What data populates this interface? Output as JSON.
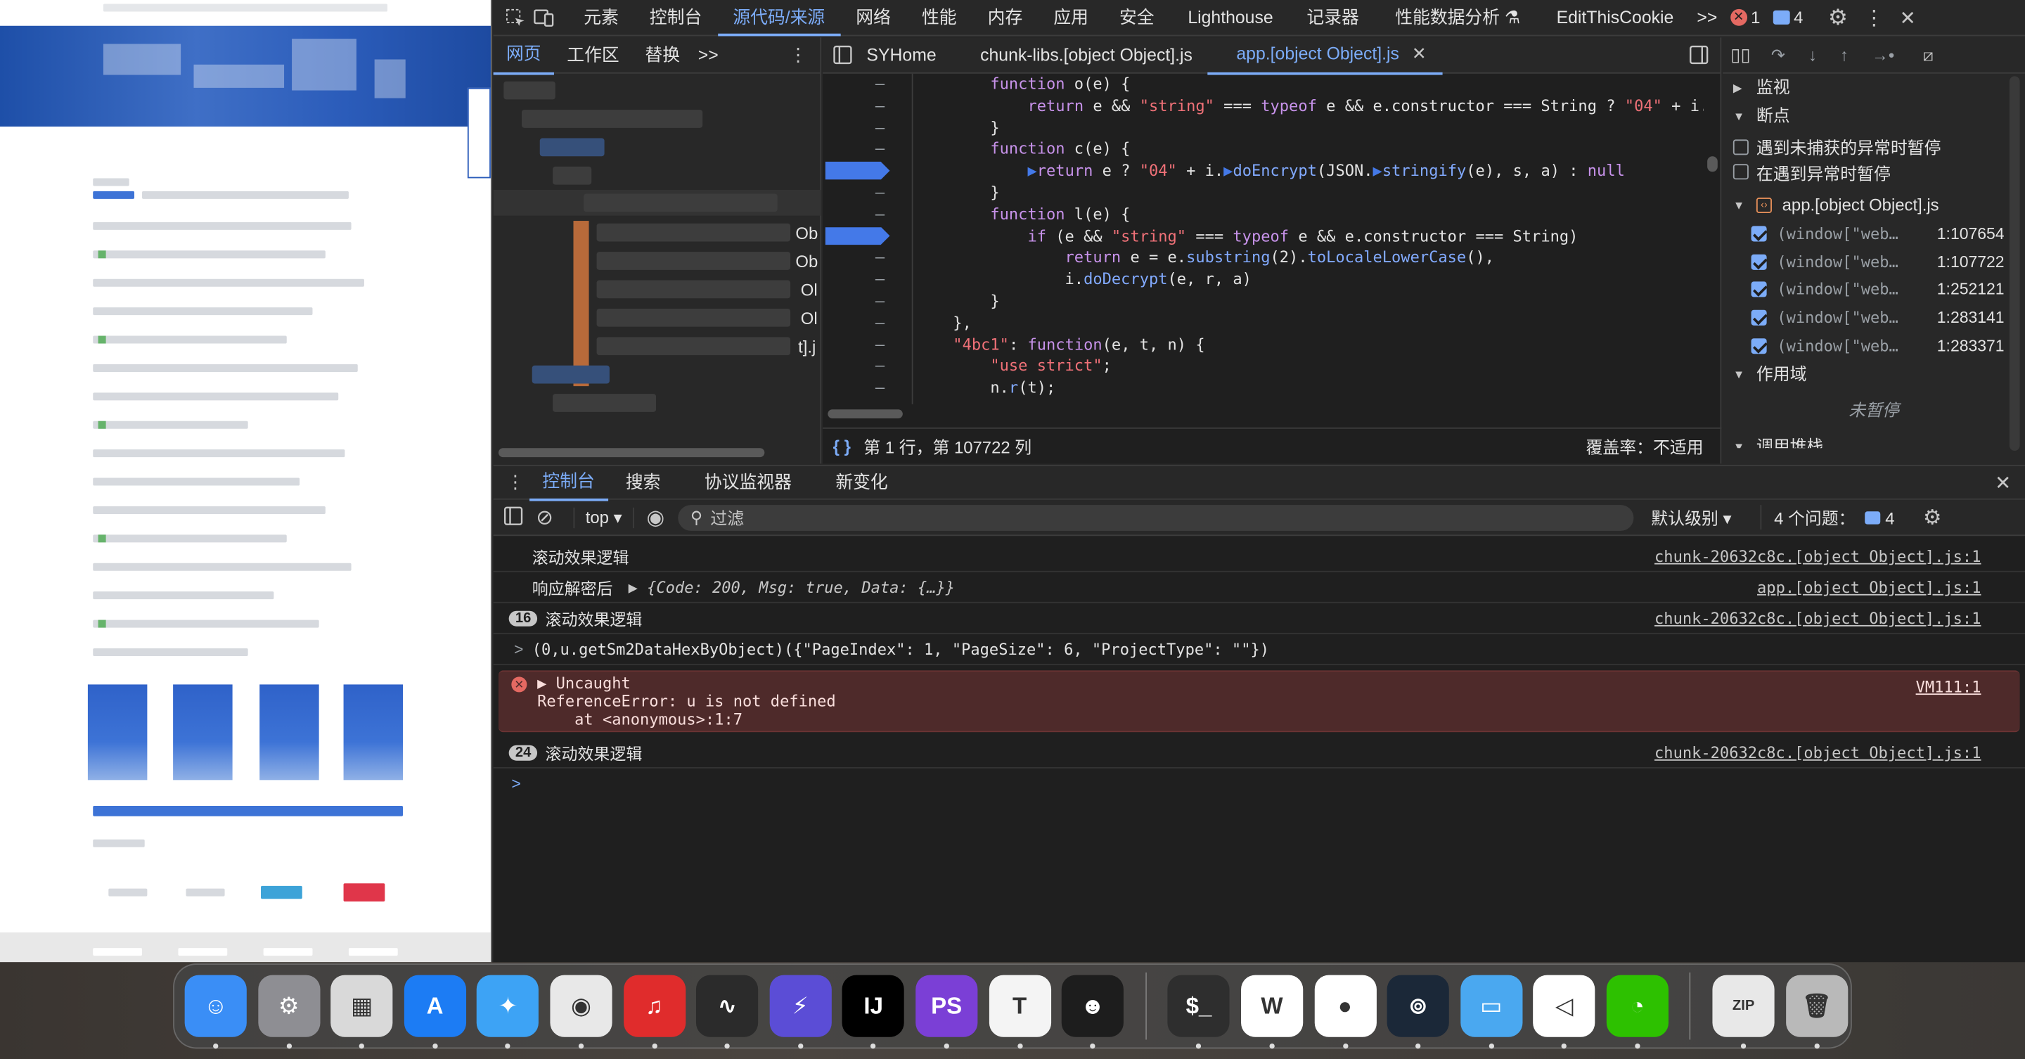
{
  "topbar": {
    "tabs": [
      "元素",
      "控制台",
      "源代码/来源",
      "网络",
      "性能",
      "内存",
      "应用",
      "安全",
      "Lighthouse",
      "记录器",
      "性能数据分析 ⚗",
      "EditThisCookie"
    ],
    "active_tab": "源代码/来源",
    "more": ">>",
    "error_count": "1",
    "message_count": "4"
  },
  "navigator": {
    "tabs": [
      "网页",
      "工作区",
      "替换"
    ],
    "active_tab": "网页",
    "more": ">>",
    "visible_fragments": [
      "Ob",
      "Ob",
      "Ol",
      "Ol",
      "t].j"
    ]
  },
  "editor": {
    "tabs": [
      "SYHome",
      "chunk-libs.[object Object].js",
      "app.[object Object].js"
    ],
    "active_tab": "app.[object Object].js",
    "status_position": "第 1 行，第 107722 列",
    "coverage": "覆盖率：不适用"
  },
  "debugger": {
    "watch": "监视",
    "breakpoints": "断点",
    "pause_uncaught": "遇到未捕获的异常时暂停",
    "pause_caught": "在遇到异常时暂停",
    "file": "app.[object Object].js",
    "bp_items": [
      {
        "name": "(window[\"web…",
        "loc": "1:107654"
      },
      {
        "name": "(window[\"web…",
        "loc": "1:107722"
      },
      {
        "name": "(window[\"web…",
        "loc": "1:252121"
      },
      {
        "name": "(window[\"web…",
        "loc": "1:283141"
      },
      {
        "name": "(window[\"web…",
        "loc": "1:283371"
      }
    ],
    "scope": "作用域",
    "not_paused": "未暂停",
    "call_stack": "调用堆栈"
  },
  "drawer": {
    "tabs": [
      "控制台",
      "搜索",
      "协议监视器",
      "新变化"
    ],
    "active_tab": "控制台",
    "context": "top ▾",
    "filter_placeholder": "过滤",
    "level": "默认级别 ▾",
    "issues": "4 个问题：",
    "issues_count": "4"
  },
  "console": {
    "m1_text": "滚动效果逻辑",
    "m1_src": "chunk-20632c8c.[object Object].js:1",
    "m2_text": "响应解密后",
    "m2_obj": "▶ {Code: 200, Msg: true, Data: {…}}",
    "m2_src": "app.[object Object].js:1",
    "m3_count": "16",
    "m3_text": "滚动效果逻辑",
    "m3_src": "chunk-20632c8c.[object Object].js:1",
    "m4_prompt": ">",
    "m4_code": "(0,u.getSm2DataHexByObject)({\"PageIndex\": 1, \"PageSize\": 6, \"ProjectType\": \"\"})",
    "err_title": "▶ Uncaught",
    "err_line1": "ReferenceError: u is not defined",
    "err_line2": "    at <anonymous>:1:7",
    "err_src": "VM111:1",
    "m5_count": "24",
    "m5_text": "滚动效果逻辑",
    "m5_src": "chunk-20632c8c.[object Object].js:1",
    "prompt": ">"
  },
  "code_lines": [
    "function o(e) {",
    "    return e && \"string\" === typeof e && e.constructor === String ? \"04\" + i.",
    "}",
    "function c(e) {",
    "    ▶return e ? \"04\" + i.▶doEncrypt(JSON.▶stringify(e), s, a) : null",
    "}",
    "function l(e) {",
    "    if (e && \"string\" === typeof e && e.constructor === String)",
    "        return e = e.substring(2).toLocaleLowerCase(),",
    "        i.doDecrypt(e, r, a)",
    "}",
    "},",
    "\"4bc1\": function(e, t, n) {",
    "    \"use strict\";",
    "    n.r(t);"
  ],
  "dock": {
    "icons": [
      {
        "name": "finder-icon",
        "color": "#3a8ef6",
        "glyph": "☺"
      },
      {
        "name": "system-settings-icon",
        "color": "#8e8e93",
        "glyph": "⚙"
      },
      {
        "name": "launchpad-icon",
        "color": "#d9d9d9",
        "glyph": "▦"
      },
      {
        "name": "app-store-icon",
        "color": "#1c7cf4",
        "glyph": "A"
      },
      {
        "name": "safari-icon",
        "color": "#3da3f5",
        "glyph": "✦"
      },
      {
        "name": "chrome-icon",
        "color": "#e8e8e8",
        "glyph": "◉"
      },
      {
        "name": "netease-music-icon",
        "color": "#e02c2c",
        "glyph": "♫"
      },
      {
        "name": "activity-monitor-icon",
        "color": "#2b2b2b",
        "glyph": "∿"
      },
      {
        "name": "shortcuts-icon",
        "color": "#5b4dd6",
        "glyph": "⚡"
      },
      {
        "name": "intellij-icon",
        "color": "#000000",
        "glyph": "IJ"
      },
      {
        "name": "phpstorm-icon",
        "color": "#7b3fd6",
        "glyph": "PS"
      },
      {
        "name": "typora-icon",
        "color": "#f4f4f4",
        "glyph": "T"
      },
      {
        "name": "robot-app-icon",
        "color": "#1d1d1d",
        "glyph": "☻"
      },
      {
        "name": "terminal-icon",
        "color": "#2e2e2e",
        "glyph": "$_"
      },
      {
        "name": "wps-icon",
        "color": "#ffffff",
        "glyph": "W"
      },
      {
        "name": "qq-icon",
        "color": "#ffffff",
        "glyph": "●"
      },
      {
        "name": "steam-icon",
        "color": "#1b2838",
        "glyph": "⊚"
      },
      {
        "name": "folder-icon",
        "color": "#4aa8f0",
        "glyph": "▭"
      },
      {
        "name": "vscode-icon",
        "color": "#ffffff",
        "glyph": "◁"
      },
      {
        "name": "wechat-icon",
        "color": "#2dc100",
        "glyph": "◔"
      },
      {
        "name": "archive-icon",
        "color": "#e8e8e8",
        "glyph": "ZIP"
      },
      {
        "name": "trash-icon",
        "color": "#b9b9b9",
        "glyph": "🗑"
      }
    ]
  },
  "colors": {
    "accent": "#7cacf8",
    "breakpoint": "#4479e8",
    "error_bg": "#4e2a2a",
    "panel_bg": "#282828",
    "editor_bg": "#1f1f1f"
  }
}
